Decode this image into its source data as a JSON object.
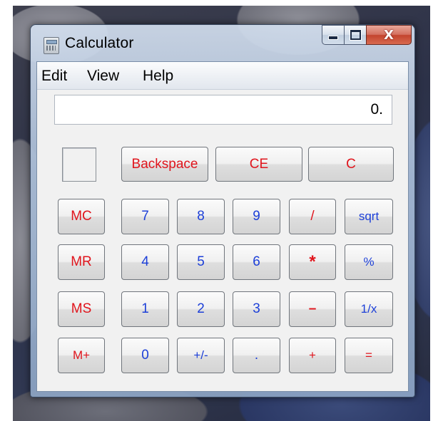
{
  "window": {
    "title": "Calculator"
  },
  "controls": {
    "minimize": "minimize",
    "maximize": "maximize",
    "close": "X"
  },
  "menu": [
    "Edit",
    "View",
    "Help"
  ],
  "display": {
    "value": "0."
  },
  "buttons": {
    "backspace": "Backspace",
    "ce": "CE",
    "c": "C",
    "mc": "MC",
    "mr": "MR",
    "ms": "MS",
    "mplus": "M+",
    "n7": "7",
    "n8": "8",
    "n9": "9",
    "div": "/",
    "sqrt": "sqrt",
    "n4": "4",
    "n5": "5",
    "n6": "6",
    "mul": "*",
    "pct": "%",
    "n1": "1",
    "n2": "2",
    "n3": "3",
    "sub": "–",
    "inv": "1/x",
    "n0": "0",
    "neg": "+/-",
    "dot": ".",
    "add": "+",
    "eq": "="
  },
  "colors": {
    "digit": "#1c3fd8",
    "operator": "#e0141c",
    "close": "#c3442e"
  }
}
